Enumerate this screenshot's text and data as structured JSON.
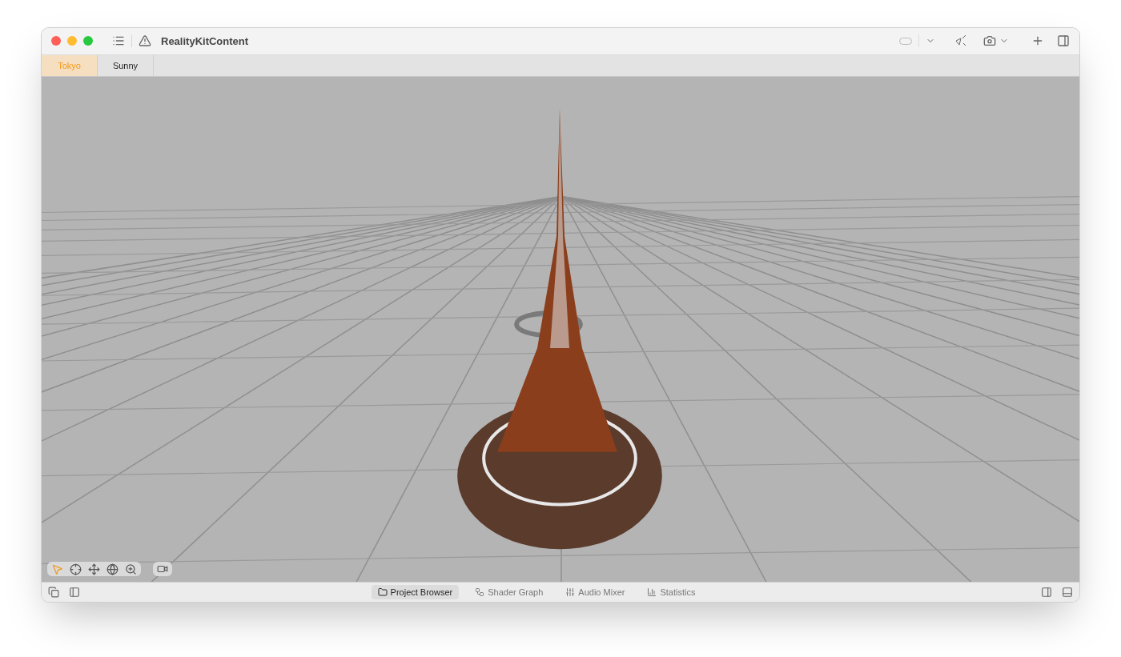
{
  "window": {
    "title": "RealityKitContent"
  },
  "tabs": [
    {
      "label": "Tokyo",
      "selected": true
    },
    {
      "label": "Sunny",
      "selected": false
    }
  ],
  "viewport_tools": [
    {
      "kind": "select",
      "selected": true
    },
    {
      "kind": "orbit",
      "selected": false
    },
    {
      "kind": "move",
      "selected": false
    },
    {
      "kind": "globe",
      "selected": false
    },
    {
      "kind": "zoom",
      "selected": false
    }
  ],
  "bottom_tabs": [
    {
      "kind": "folder",
      "label": "Project Browser",
      "selected": true
    },
    {
      "kind": "graph",
      "label": "Shader Graph",
      "selected": false
    },
    {
      "kind": "mixer",
      "label": "Audio Mixer",
      "selected": false
    },
    {
      "kind": "stats",
      "label": "Statistics",
      "selected": false
    }
  ]
}
